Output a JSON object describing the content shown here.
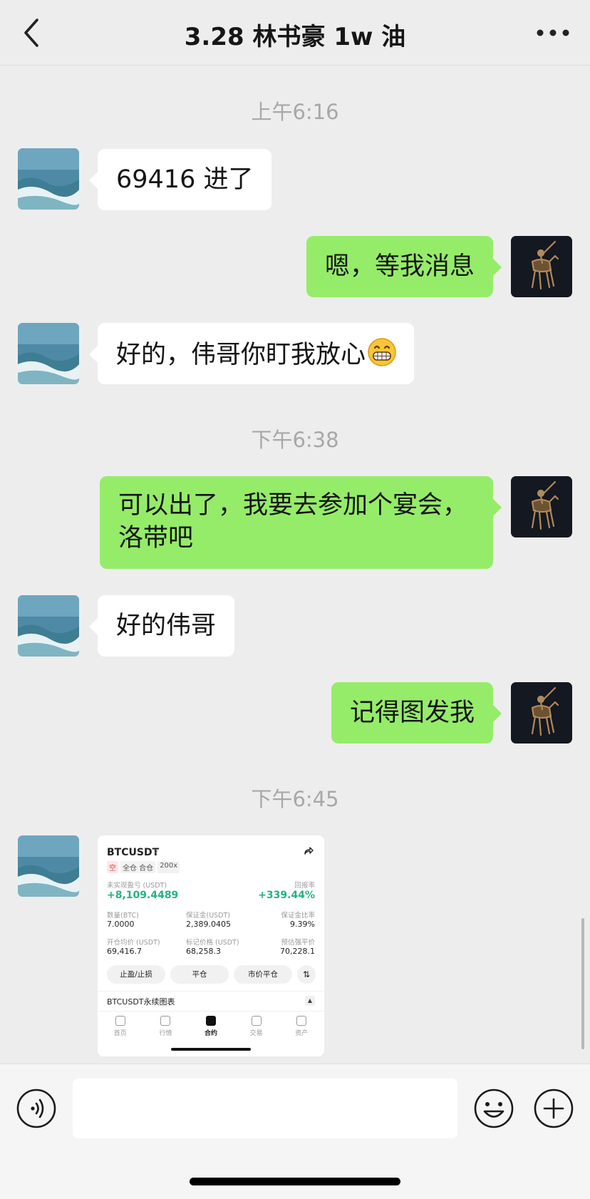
{
  "header": {
    "title": "3.28 林书豪 1w 油"
  },
  "messages": {
    "time1": "上午6:16",
    "m1": "69416 进了",
    "m2": "嗯，等我消息",
    "m3": "好的，伟哥你盯我放心",
    "time2": "下午6:38",
    "m4_line1": "可以出了，我要去参加个宴会，",
    "m4_line2": "洛带吧",
    "m5": "好的伟哥",
    "m6": "记得图发我",
    "time3": "下午6:45"
  },
  "trade_screenshot": {
    "symbol": "BTCUSDT",
    "tags": [
      "空",
      "全仓 合仓",
      "200x"
    ],
    "unrealized_pnl_label": "未实现盈亏 (USDT)",
    "unrealized_pnl": "+8,109.4489",
    "roe_label": "回报率",
    "roe": "+339.44%",
    "qty_label": "数量(BTC)",
    "qty": "7.0000",
    "margin_label": "保证金(USDT)",
    "margin": "2,389.0405",
    "margin_ratio_label": "保证金比率",
    "margin_ratio": "9.39%",
    "entry_label": "开仓均价 (USDT)",
    "entry": "69,416.7",
    "mark_label": "标记价格 (USDT)",
    "mark": "68,258.3",
    "liq_label": "预估强平价",
    "liq": "70,228.1",
    "btn_tpsl": "止盈/止损",
    "btn_close": "平仓",
    "btn_market_close": "市价平仓",
    "chart_title": "BTCUSDT永续图表",
    "tabs": [
      "首页",
      "行情",
      "合约",
      "交易",
      "资产"
    ]
  },
  "colors": {
    "background": "#ededed",
    "green_bubble": "#95ec69",
    "white_bubble": "#ffffff",
    "profit_green": "#22b383"
  }
}
